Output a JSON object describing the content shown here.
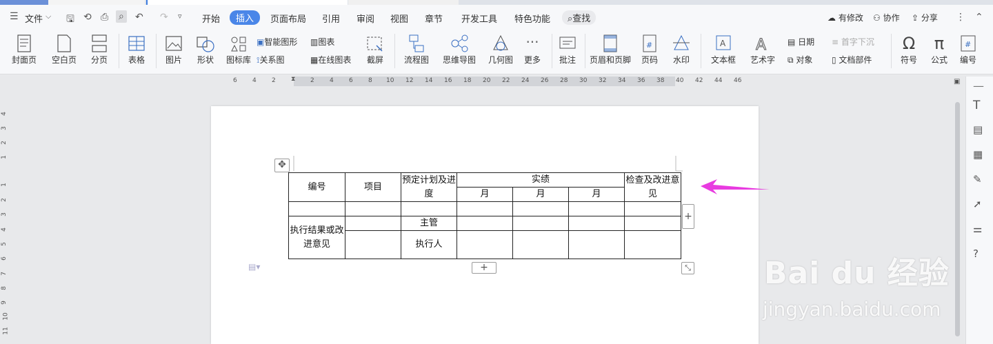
{
  "menu": {
    "file": "文件",
    "tabs": [
      "开始",
      "插入",
      "页面布局",
      "引用",
      "审阅",
      "视图",
      "章节",
      "开发工具",
      "特色功能"
    ],
    "active_tab": "插入",
    "search": "查找",
    "right": [
      "有修改",
      "协作",
      "分享"
    ]
  },
  "ribbon": {
    "cover": "封面页",
    "blank": "空白页",
    "break": "分页",
    "table": "表格",
    "picture": "图片",
    "shape": "形状",
    "iconlib": "图标库",
    "smartart": "智能图形",
    "chart": "图表",
    "relation": "关系图",
    "online_chart": "在线图表",
    "screenshot": "截屏",
    "flowchart": "流程图",
    "mindmap": "思维导图",
    "geometry": "几何图",
    "more": "更多",
    "comment": "批注",
    "header_footer": "页眉和页脚",
    "page_num": "页码",
    "watermark": "水印",
    "textbox": "文本框",
    "wordart": "艺术字",
    "date": "日期",
    "object": "对象",
    "dropcap": "首字下沉",
    "doc_parts": "文档部件",
    "symbol": "符号",
    "formula": "公式",
    "numbering": "编号"
  },
  "ruler_h": [
    "6",
    "4",
    "2",
    "2",
    "4",
    "6",
    "8",
    "10",
    "12",
    "14",
    "16",
    "18",
    "20",
    "22",
    "24",
    "26",
    "28",
    "30",
    "32",
    "34",
    "36",
    "38",
    "40",
    "42",
    "44",
    "46"
  ],
  "ruler_v": [
    "4",
    "3",
    "2",
    "1",
    "1",
    "2",
    "3",
    "4",
    "5",
    "6",
    "7",
    "8",
    "9",
    "10",
    "11"
  ],
  "table": {
    "h_num": "编号",
    "h_item": "项目",
    "h_plan": "预定计划及进度",
    "h_actual": "实绩",
    "h_review": "检查及改进意见",
    "month": "月",
    "exec_result": "执行结果或改进意见",
    "supervisor": "主管",
    "executor": "执行人"
  },
  "watermark": {
    "brand": "Bai du 经验",
    "url": "jingyan.baidu.com"
  },
  "colors": {
    "accent": "#4a86e8",
    "arrow": "#e83be0"
  }
}
